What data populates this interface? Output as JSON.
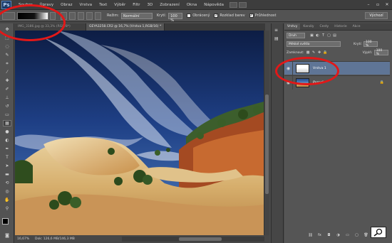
{
  "menubar": {
    "logo": "Ps",
    "items": [
      "Soubor",
      "Úpravy",
      "Obraz",
      "Vrstva",
      "Text",
      "Výběr",
      "Filtr",
      "3D",
      "Zobrazení",
      "Okna",
      "Nápověda"
    ],
    "window_controls": [
      "–",
      "▫",
      "✕"
    ]
  },
  "options_bar": {
    "mode_label": "Režim:",
    "mode_value": "Normální",
    "opacity_label": "Krytí:",
    "opacity_value": "100 %",
    "reverse_label": "Obrácený",
    "dither_label": "Rozklad barev",
    "transparency_label": "Průhlednost",
    "workspace": "Výchozí"
  },
  "tabs": [
    {
      "label": "IMG_3186.jpg @ 33,3% (RGB/8*)",
      "active": false
    },
    {
      "label": "GEYA3258.CR2 @ 16,7% (Vrstva 1,RGB/16) *",
      "active": true
    }
  ],
  "status": {
    "zoom": "16,67%",
    "doc": "Dok: 126,6 MB/146,3 MB"
  },
  "panel": {
    "tabs": [
      "Vrstvy",
      "Kanály",
      "Cesty",
      "Historie",
      "Akce"
    ],
    "filter": "Druh",
    "blend_mode": "Měkké světlo",
    "opacity_label": "Krytí:",
    "opacity_value": "100 %",
    "lock_label": "Zamknout:",
    "fill_label": "Výplň:",
    "fill_value": "100 %",
    "layers": [
      {
        "name": "Vrstva 1",
        "selected": true
      },
      {
        "name": "Pozadí",
        "selected": false
      }
    ]
  },
  "colors": {
    "annotation_red": "#e21818",
    "selected_layer": "#5f7596"
  }
}
